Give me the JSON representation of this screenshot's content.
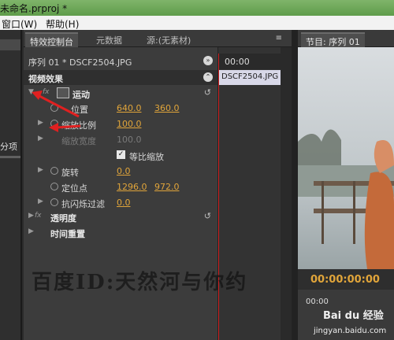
{
  "window": {
    "title": "未命名.prproj *",
    "menu": [
      "窗口(W)",
      "帮助(H)"
    ]
  },
  "left_panel": {
    "label": "分项"
  },
  "tabs": [
    {
      "label": "特效控制台",
      "active": true
    },
    {
      "label": "元数据",
      "active": false
    },
    {
      "label": "源:(无素材)",
      "active": false
    }
  ],
  "effect_controls": {
    "sequence": "序列 01 * DSCF2504.JPG",
    "section": "视频效果",
    "rows": [
      {
        "name": "运动",
        "bold": true
      },
      {
        "name": "位置",
        "v1": "640.0",
        "v2": "360.0"
      },
      {
        "name": "缩放比例",
        "v1": "100.0"
      },
      {
        "name": "缩放宽度",
        "v1": "100.0",
        "dim": true
      },
      {
        "name": "等比缩放",
        "checked": true
      },
      {
        "name": "旋转",
        "v1": "0.0"
      },
      {
        "name": "定位点",
        "v1": "1296.0",
        "v2": "972.0"
      },
      {
        "name": "抗闪烁过滤",
        "v1": "0.0"
      },
      {
        "name": "透明度",
        "bold": true
      },
      {
        "name": "时间重置",
        "bold": true
      }
    ]
  },
  "timeline": {
    "timecode": "00:00",
    "clip": "DSCF2504.JPG"
  },
  "program": {
    "tab": "节目: 序列 01",
    "timecode": "00:00:00:00",
    "ruler_tc": "00:00"
  },
  "watermark": {
    "text": "百度ID:天然河与你约",
    "brand": "Bai du 经验",
    "site": "jingyan.baidu.com"
  }
}
